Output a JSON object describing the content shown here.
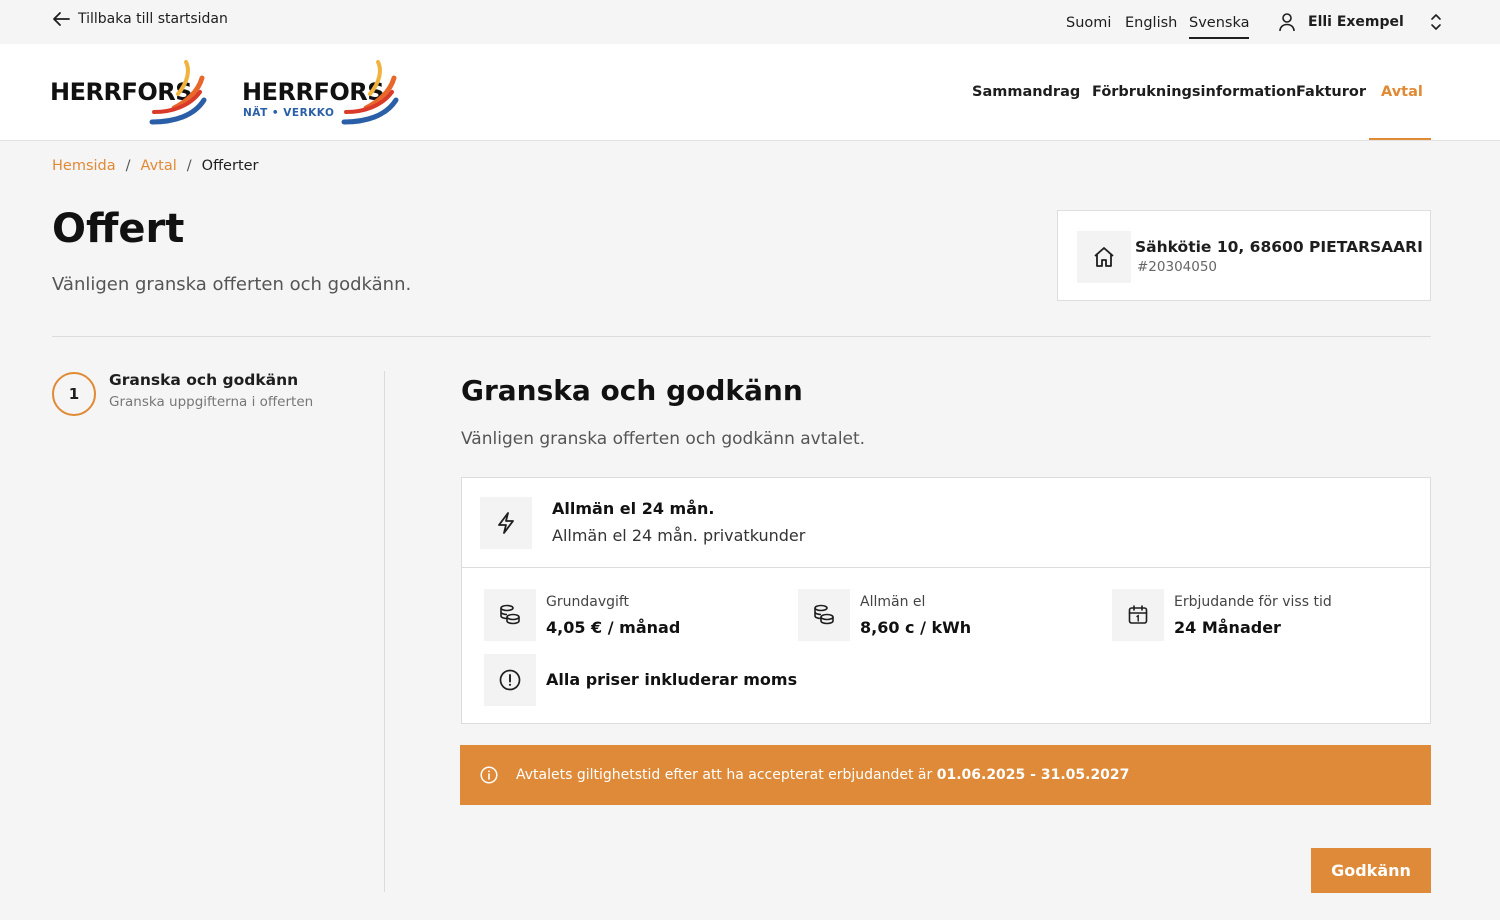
{
  "topbar": {
    "back_label": "Tillbaka till startsidan",
    "languages": [
      "Suomi",
      "English",
      "Svenska"
    ],
    "active_language": "Svenska",
    "user_name": "Elli Exempel"
  },
  "header": {
    "logo_text_1": "HERRFORS",
    "logo_text_2": "HERRFORS",
    "logo_sub_2": "NÄT • VERKKO",
    "nav": [
      "Sammandrag",
      "Förbrukningsinformation",
      "Fakturor",
      "Avtal"
    ],
    "active_nav": "Avtal"
  },
  "breadcrumb": {
    "items": [
      "Hemsida",
      "Avtal",
      "Offerter"
    ],
    "separator": "/"
  },
  "page": {
    "title": "Offert",
    "subtitle": "Vänligen granska offerten och godkänn."
  },
  "address": {
    "line": "Sähkötie 10, 68600 PIETARSAARI",
    "number": "#20304050"
  },
  "stepper": {
    "number": "1",
    "title": "Granska och godkänn",
    "subtitle": "Granska uppgifterna i offerten"
  },
  "section": {
    "title": "Granska och godkänn",
    "subtitle": "Vänligen granska offerten och godkänn avtalet."
  },
  "offer": {
    "name": "Allmän el 24 mån.",
    "description": "Allmän el 24 mån. privatkunder",
    "prices": [
      {
        "label": "Grundavgift",
        "value": "4,05 € / månad",
        "icon": "coins-icon"
      },
      {
        "label": "Allmän el",
        "value": "8,60 c / kWh",
        "icon": "coins-icon"
      },
      {
        "label": "Erbjudande för viss tid",
        "value": "24 Månader",
        "icon": "calendar-icon"
      }
    ],
    "vat_note": "Alla priser inkluderar moms"
  },
  "banner": {
    "text": "Avtalets giltighetstid efter att ha accepterat erbjudandet är",
    "dates": "01.06.2025 - 31.05.2027"
  },
  "actions": {
    "approve_label": "Godkänn"
  },
  "colors": {
    "accent": "#df8a38",
    "background": "#f5f5f5",
    "card": "#ffffff",
    "text": "#1e1e1e"
  }
}
